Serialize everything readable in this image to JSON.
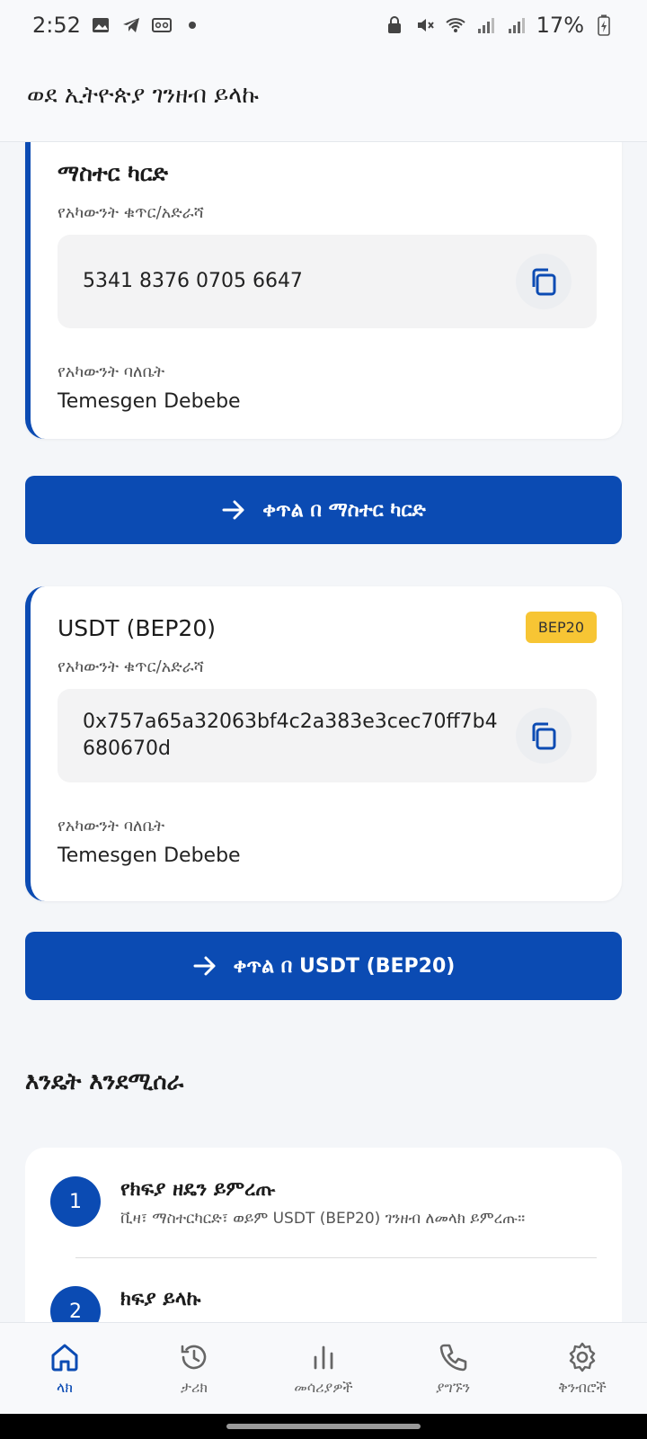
{
  "status_bar": {
    "time": "2:52",
    "battery": "17%"
  },
  "app_bar": {
    "title": "ወደ ኢትዮጵያ ገንዘብ ይላኩ"
  },
  "accounts": [
    {
      "title": "ማስተር ካርድ",
      "number_label": "የአካውንት ቁጥር/አድራሻ",
      "number": "5341 8376 0705 6647",
      "owner_label": "የአካውንት ባለቤት",
      "owner": "Temesgen Debebe",
      "button_label": "ቀጥል በ ማስተር ካርድ"
    },
    {
      "title": "USDT (BEP20)",
      "badge": "BEP20",
      "number_label": "የአካውንት ቁጥር/አድራሻ",
      "number": "0x757a65a32063bf4c2a383e3cec70ff7b4680670d",
      "owner_label": "የአካውንት ባለቤት",
      "owner": "Temesgen Debebe",
      "button_label": "ቀጥል በ USDT (BEP20)"
    }
  ],
  "how_it_works": {
    "title": "እንዴት እንደሚሰራ",
    "steps": [
      {
        "number": "1",
        "title": "የክፍያ ዘዴን ይምረጡ",
        "desc": "ቪዛ፣ ማስተርካርድ፣ ወይም USDT (BEP20) ገንዘብ ለመላክ ይምረጡ።"
      },
      {
        "number": "2",
        "title": "ክፍያ ይላኩ"
      }
    ]
  },
  "nav": [
    {
      "label": "ላክ",
      "icon": "home-icon",
      "active": true
    },
    {
      "label": "ታሪክ",
      "icon": "history-icon"
    },
    {
      "label": "መሳሪያዎች",
      "icon": "chart-icon"
    },
    {
      "label": "ያግኙን",
      "icon": "phone-icon"
    },
    {
      "label": "ቅንብሮች",
      "icon": "gear-icon"
    }
  ],
  "colors": {
    "primary": "#0b4bb3",
    "badge": "#f7c534",
    "background": "#f4f6f9"
  }
}
